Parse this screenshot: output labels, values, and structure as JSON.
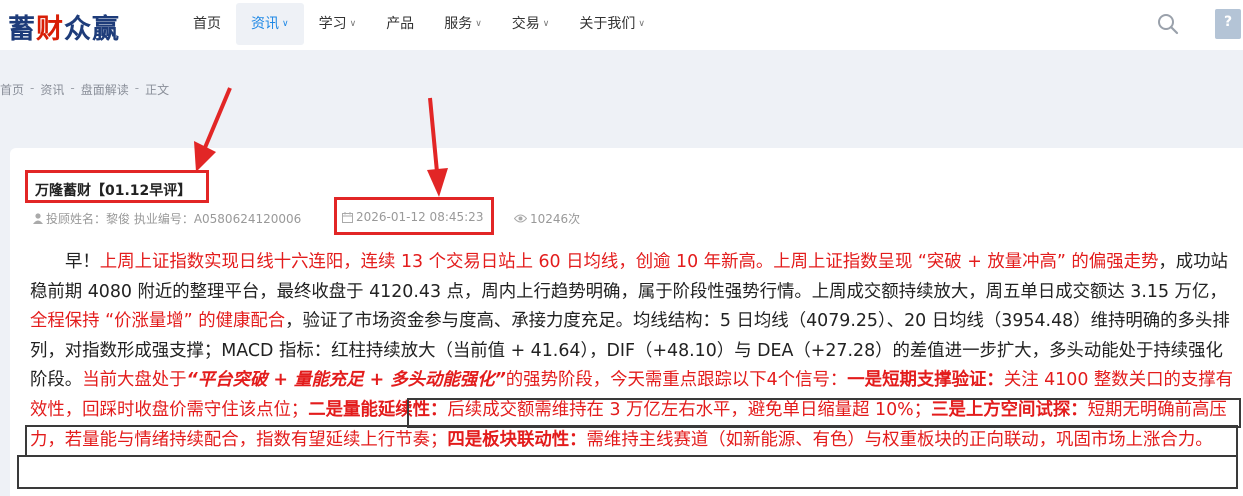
{
  "header": {
    "logo_part1": "蓄",
    "logo_part2": "财",
    "logo_part3": "众赢",
    "nav": [
      {
        "label": "首页",
        "caret": false,
        "active": false
      },
      {
        "label": "资讯",
        "caret": true,
        "active": true
      },
      {
        "label": "学习",
        "caret": true,
        "active": false
      },
      {
        "label": "产品",
        "caret": false,
        "active": false
      },
      {
        "label": "服务",
        "caret": true,
        "active": false
      },
      {
        "label": "交易",
        "caret": true,
        "active": false
      },
      {
        "label": "关于我们",
        "caret": true,
        "active": false
      }
    ]
  },
  "breadcrumb": [
    "首页",
    "资讯",
    "盘面解读",
    "正文"
  ],
  "article": {
    "title": "万隆蓄财【01.12早评】",
    "advisor": "投顾姓名：黎俊 执业编号：A0580624120006",
    "datetime": "2026-01-12 08:45:23",
    "views": "10246次",
    "body": {
      "s1": "早！",
      "s2": "上周上证指数实现日线十六连阳，连续 13 个交易日站上 60 日均线，创逾 10 年新高。上周上证指数呈现 “突破 + 放量冲高” 的偏强走势",
      "s3": "，成功站稳前期 4080 附近的整理平台，最终收盘于 4120.43 点，周内上行趋势明确，属于阶段性强势行情。上周成交额持续放大，周五单日成交额达 3.15 万亿，",
      "s4": "全程保持 “价涨量增” 的健康配合",
      "s5": "，验证了市场资金参与度高、承接力度充足。均线结构：5 日均线（4079.25）、20 日均线（3954.48）维持明确的多头排列，对指数形成强支撑；MACD 指标：红柱持续放大（当前值 + 41.64），DIF（+48.10）与 DEA（+27.28）的差值进一步扩大，多头动能处于持续强化阶段。",
      "s6": "当前大盘处于",
      "s7": "“平台突破 + 量能充足 + 多头动能强化”",
      "s8": "的强势阶段，今天需重点跟踪以下4个信号：",
      "s9": "一是短期支撑验证：",
      "s10": "关注 4100 整数关口的支撑有效性，回踩时收盘价需守住该点位；",
      "s11": "二是量能延续性：",
      "s12": "后续成交额需维持在 3 万亿左右水平，避免单日缩量超 10%；",
      "s13": "三是上方空间试探：",
      "s14": "短期无明确前高压力，若量能与情绪持续配合，指数有望延续上行节奏；",
      "s15": "四是板块联动性：",
      "s16": "需维持主线赛道（如新能源、有色）与权重板块的正向联动，巩固市场上涨合力。"
    }
  },
  "colors": {
    "accent_red": "#e31c1c",
    "nav_active": "#1e88e5",
    "logo_blue": "#1e3c7a"
  }
}
